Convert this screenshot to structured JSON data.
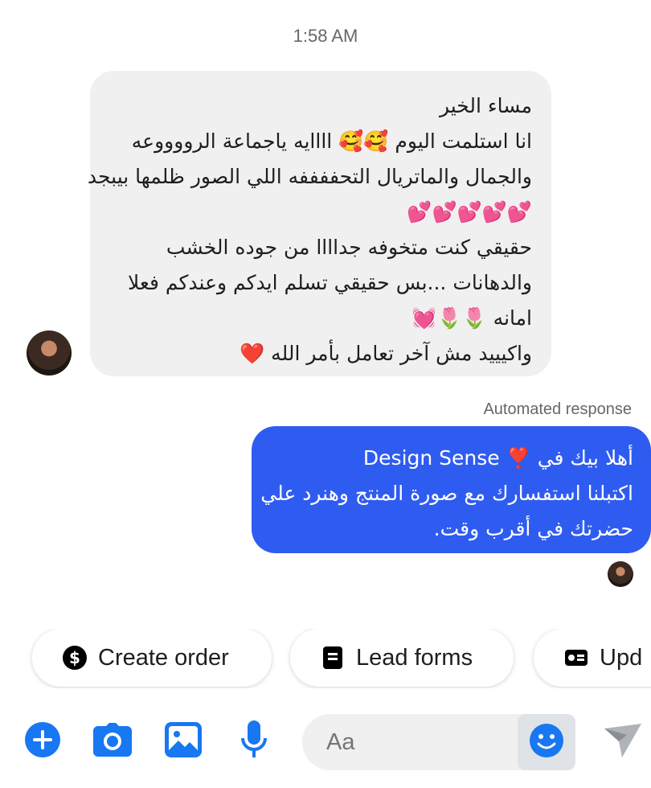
{
  "timestamp": "1:58 AM",
  "incoming_message": {
    "lines": [
      "مساء الخير",
      "انا استلمت اليوم 🥰🥰 اااايه ياجماعة الرووووعه",
      "والجمال والماتريال التحففففه اللي الصور ظلمها بيبجد",
      "💕💕💕💕💕",
      "حقيقي كنت متخوفه جداااا من جوده الخشب",
      "والدهانات ...بس حقيقي تسلم ايدكم وعندكم فعلا",
      "امانه 🌷🌷💓",
      "واكيييد مش آخر تعامل بأمر الله ❤️"
    ]
  },
  "automated_label": "Automated response",
  "outgoing_message": {
    "lines": [
      "أهلا بيك في ❣️ Design Sense",
      "اكتبلنا استفسارك مع صورة المنتج وهنرد علي",
      "حضرتك في أقرب وقت."
    ]
  },
  "quick_actions": [
    {
      "label": "Create order",
      "icon": "dollar-circle-icon"
    },
    {
      "label": "Lead forms",
      "icon": "form-icon"
    },
    {
      "label": "Upd",
      "icon": "contact-card-icon"
    }
  ],
  "composer": {
    "placeholder": "Aa",
    "accent_color": "#2f5cf0"
  },
  "colors": {
    "incoming_bubble": "#f0f0f0",
    "outgoing_bubble": "#2f5cf0",
    "icon_blue": "#1877f2"
  }
}
